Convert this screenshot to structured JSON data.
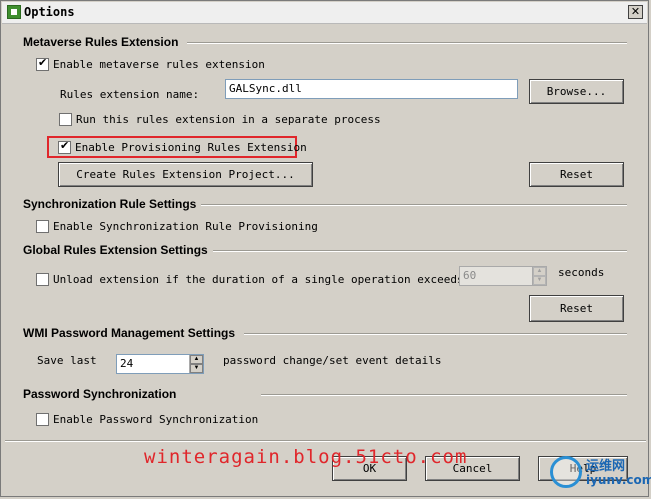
{
  "window": {
    "title": "Options",
    "close_glyph": "✕"
  },
  "sections": {
    "metaverse": {
      "title": "Metaverse Rules Extension",
      "enable_label": "Enable metaverse rules extension",
      "enable_checked": true,
      "name_label": "Rules extension name:",
      "name_value": "GALSync.dll",
      "browse_label": "Browse...",
      "separate_process_label": "Run this rules extension in a separate process",
      "separate_process_checked": false,
      "provisioning_label": "Enable Provisioning Rules Extension",
      "provisioning_checked": true,
      "create_project_label": "Create Rules Extension Project...",
      "reset_label": "Reset"
    },
    "sync_rules": {
      "title": "Synchronization Rule Settings",
      "enable_label": "Enable Synchronization Rule Provisioning",
      "enable_checked": false
    },
    "global_rules": {
      "title": "Global Rules Extension Settings",
      "unload_label": "Unload extension if the duration of a single operation exceeds:",
      "unload_checked": false,
      "seconds_value": "60",
      "seconds_label": "seconds",
      "reset_label": "Reset"
    },
    "wmi": {
      "title": "WMI Password Management Settings",
      "save_last_label": "Save last",
      "save_last_value": "24",
      "details_label": "password change/set event details"
    },
    "password_sync": {
      "title": "Password Synchronization",
      "enable_label": "Enable Password Synchronization",
      "enable_checked": false
    }
  },
  "footer": {
    "ok_label": "OK",
    "cancel_label": "Cancel",
    "help_label": "Help"
  },
  "watermark": {
    "text": "winteragain.blog.51cto.com",
    "logo_cn": "运维网",
    "logo_en": "iyunv.com"
  },
  "colors": {
    "highlight": "#e0262b",
    "dialog_bg": "#d4d0c8"
  }
}
